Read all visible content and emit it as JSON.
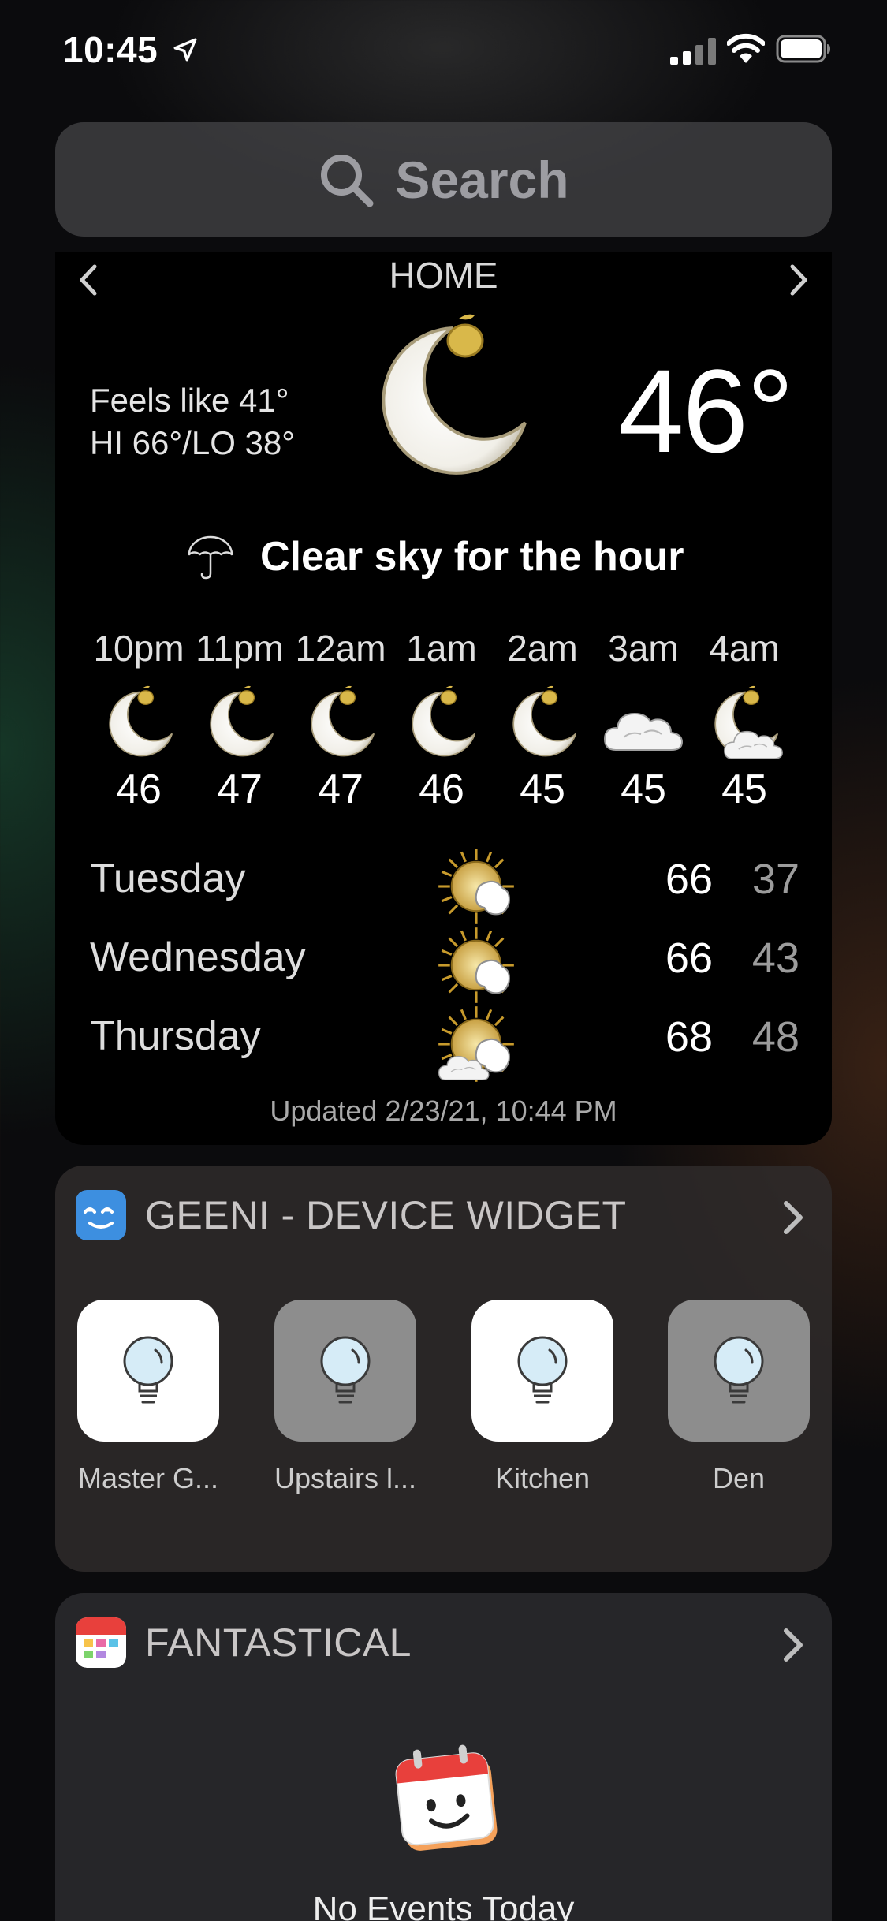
{
  "status_bar": {
    "time": "10:45",
    "icons": [
      "location-arrow-icon",
      "cellular-signal-icon",
      "wifi-icon",
      "battery-icon"
    ]
  },
  "search": {
    "placeholder": "Search"
  },
  "weather": {
    "location": "HOME",
    "feels_like": "Feels like 41°",
    "hi_lo": "HI 66°/LO 38°",
    "current_temp": "46°",
    "current_icon": "moon-icon",
    "hour_summary": "Clear sky for the hour",
    "hourly": [
      {
        "time": "10pm",
        "temp": "46",
        "icon": "moon-icon"
      },
      {
        "time": "11pm",
        "temp": "47",
        "icon": "moon-icon"
      },
      {
        "time": "12am",
        "temp": "47",
        "icon": "moon-icon"
      },
      {
        "time": "1am",
        "temp": "46",
        "icon": "moon-icon"
      },
      {
        "time": "2am",
        "temp": "45",
        "icon": "moon-icon"
      },
      {
        "time": "3am",
        "temp": "45",
        "icon": "cloud-icon"
      },
      {
        "time": "4am",
        "temp": "45",
        "icon": "moon-cloud-icon"
      }
    ],
    "daily": [
      {
        "day": "Tuesday",
        "hi": "66",
        "lo": "37",
        "icon": "sun-icon"
      },
      {
        "day": "Wednesday",
        "hi": "66",
        "lo": "43",
        "icon": "sun-icon"
      },
      {
        "day": "Thursday",
        "hi": "68",
        "lo": "48",
        "icon": "sun-cloud-icon"
      }
    ],
    "updated": "Updated 2/23/21, 10:44 PM"
  },
  "geeni": {
    "title": "GEENI - DEVICE WIDGET",
    "devices": [
      {
        "label": "Master G...",
        "state": "on"
      },
      {
        "label": "Upstairs l...",
        "state": "off"
      },
      {
        "label": "Kitchen",
        "state": "on"
      },
      {
        "label": "Den",
        "state": "off"
      }
    ]
  },
  "fantastical": {
    "title": "FANTASTICAL",
    "empty_message": "No Events Today"
  },
  "colors": {
    "geeni_logo": "#3d8fe0",
    "fantastical_red": "#e8403c",
    "device_on": "#ffffff",
    "device_off": "#8d8d8d"
  }
}
